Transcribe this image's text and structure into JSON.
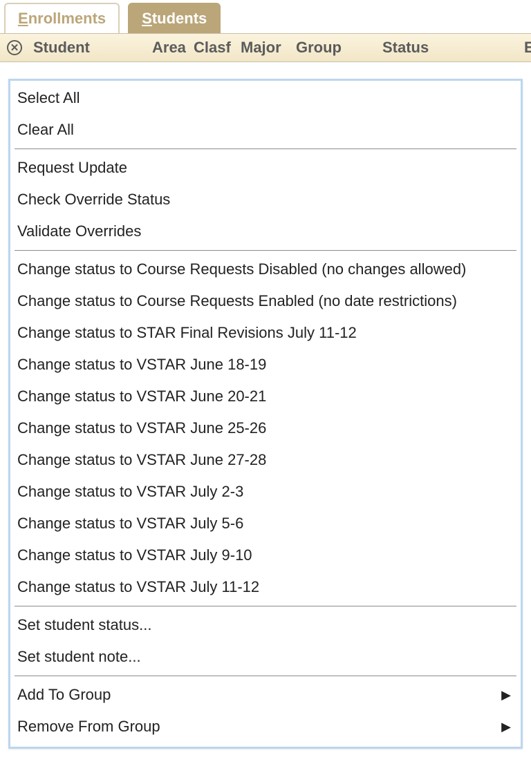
{
  "tabs": {
    "inactive_label_prefix": "E",
    "inactive_label_rest": "nrollments",
    "active_label_prefix": "S",
    "active_label_rest": "tudents"
  },
  "header": {
    "close_glyph": "✕",
    "student": "Student",
    "area": "Area",
    "clasf": "Clasf",
    "major": "Major",
    "group": "Group",
    "status": "Status",
    "trailing": "E"
  },
  "menu": {
    "group1": [
      "Select All",
      "Clear All"
    ],
    "group2": [
      "Request Update",
      "Check Override Status",
      "Validate Overrides"
    ],
    "group3": [
      "Change status to Course Requests Disabled (no changes allowed)",
      "Change status to Course Requests Enabled (no date restrictions)",
      "Change status to STAR Final Revisions July 11-12",
      "Change status to VSTAR June 18-19",
      "Change status to VSTAR June 20-21",
      "Change status to VSTAR June 25-26",
      "Change status to VSTAR June 27-28",
      "Change status to VSTAR July 2-3",
      "Change status to VSTAR July 5-6",
      "Change status to VSTAR July 9-10",
      "Change status to VSTAR July 11-12"
    ],
    "group4": [
      "Set student status...",
      "Set student note..."
    ],
    "group5": [
      {
        "label": "Add To Group",
        "has_submenu": true
      },
      {
        "label": "Remove From Group",
        "has_submenu": true
      }
    ],
    "arrow_glyph": "▶"
  }
}
